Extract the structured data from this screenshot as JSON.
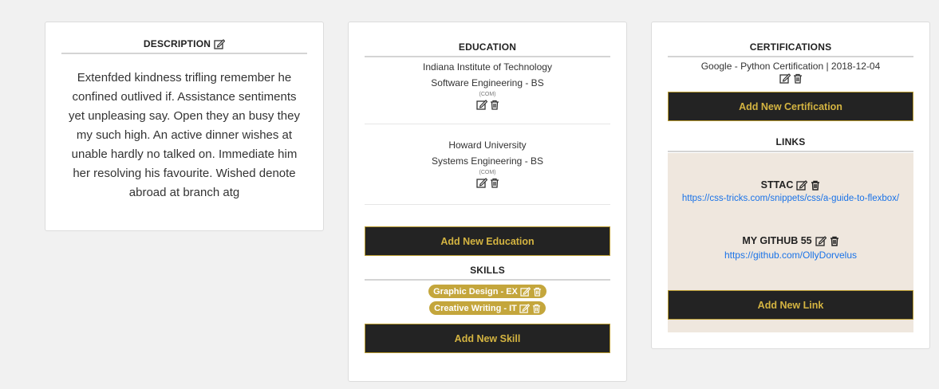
{
  "description": {
    "heading": "DESCRIPTION",
    "text": "Extenfded kindness trifling remember he confined outlived if. Assistance sentiments yet unpleasing say. Open they an busy they my such high. An active dinner wishes at unable hardly no talked on. Immediate him her resolving his favourite. Wished denote abroad at branch atg"
  },
  "education": {
    "heading": "EDUCATION",
    "items": [
      {
        "school": "Indiana Institute of Technology",
        "degree": "Software Engineering - BS",
        "tag": "(COM)"
      },
      {
        "school": "Howard University",
        "degree": "Systems Engineering - BS",
        "tag": "(COM)"
      }
    ],
    "add_label": "Add New Education"
  },
  "skills": {
    "heading": "SKILLS",
    "items": [
      {
        "label": "Graphic Design - EX"
      },
      {
        "label": "Creative Writing - IT"
      }
    ],
    "add_label": "Add New Skill"
  },
  "certifications": {
    "heading": "CERTIFICATIONS",
    "items": [
      {
        "label": "Google - Python Certification | 2018-12-04"
      }
    ],
    "add_label": "Add New Certification"
  },
  "links": {
    "heading": "LINKS",
    "items": [
      {
        "title": "STTAC",
        "url": "https://css-tricks.com/snippets/css/a-guide-to-flexbox/"
      },
      {
        "title": "MY GITHUB 55",
        "url": "https://github.com/OllyDorvelus"
      }
    ],
    "add_label": "Add New Link"
  },
  "colors": {
    "button_bg": "#232323",
    "button_text": "#d4b441",
    "pill_bg": "#c4a63c",
    "links_bg": "#efe7de",
    "link": "#1a73e8"
  },
  "icons": [
    "edit-icon",
    "trash-icon"
  ]
}
